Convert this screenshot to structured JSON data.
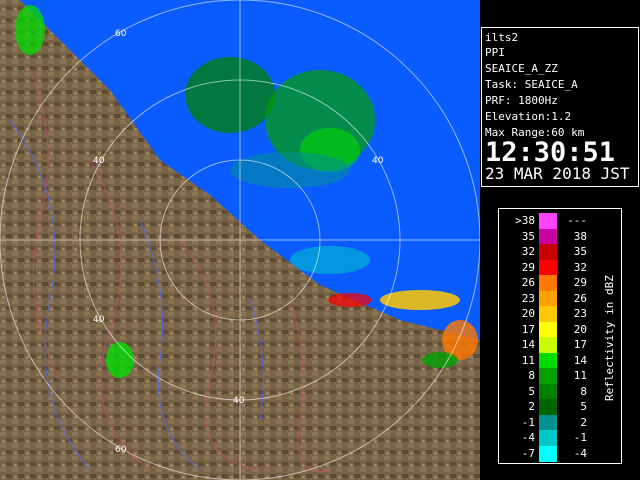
{
  "info": {
    "site": "ilts2",
    "mode": "PPI",
    "product": "SEAICE_A_ZZ",
    "task": "Task: SEAICE_A",
    "prf": "PRF: 1800Hz",
    "elevation": "Elevation:1.2",
    "max_range": "Max Range:60 km",
    "time": "12:30:51",
    "date": "23 MAR 2018 JST"
  },
  "map": {
    "range_labels": [
      "60",
      "40",
      "40",
      "40",
      "40",
      "60"
    ],
    "colors": {
      "sea": "#0a5cff",
      "land": "#7a6448"
    }
  },
  "legend": {
    "axis_label": "Reflectivity in dBZ",
    "rows": [
      {
        "low": ">38",
        "high": "---",
        "color": "#ff44ff"
      },
      {
        "low": "35",
        "high": "38",
        "color": "#c800a0"
      },
      {
        "low": "32",
        "high": "35",
        "color": "#c80000"
      },
      {
        "low": "29",
        "high": "32",
        "color": "#ff0000"
      },
      {
        "low": "26",
        "high": "29",
        "color": "#ff7800"
      },
      {
        "low": "23",
        "high": "26",
        "color": "#ffa000"
      },
      {
        "low": "20",
        "high": "23",
        "color": "#ffc800"
      },
      {
        "low": "17",
        "high": "20",
        "color": "#ffff00"
      },
      {
        "low": "14",
        "high": "17",
        "color": "#c8ff00"
      },
      {
        "low": "11",
        "high": "14",
        "color": "#00dc00"
      },
      {
        "low": "8",
        "high": "11",
        "color": "#00a000"
      },
      {
        "low": "5",
        "high": "8",
        "color": "#008000"
      },
      {
        "low": "2",
        "high": "5",
        "color": "#006400"
      },
      {
        "low": "-1",
        "high": "2",
        "color": "#009090"
      },
      {
        "low": "-4",
        "high": "-1",
        "color": "#00c8c8"
      },
      {
        "low": "-7",
        "high": "-4",
        "color": "#00ffff"
      }
    ]
  }
}
